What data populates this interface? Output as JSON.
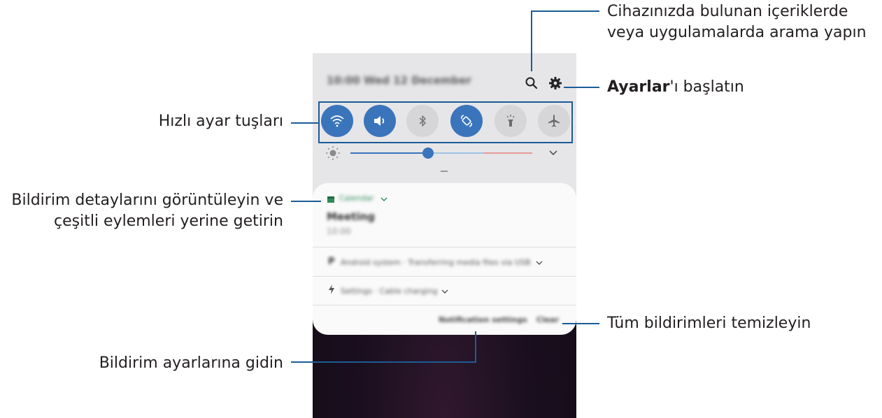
{
  "callouts": {
    "search_line1": "Cihazınızda bulunan içeriklerde",
    "search_line2": "veya uygulamalarda arama yapın",
    "settings_bold": "Ayarlar",
    "settings_rest": "'ı başlatın",
    "quick_settings": "Hızlı ayar tuşları",
    "notification_line1": "Bildirim detaylarını görüntüleyin ve",
    "notification_line2": "çeşitli eylemleri yerine getirin",
    "clear_all": "Tüm bildirimleri temizleyin",
    "notification_settings": "Bildirim ayarlarına gidin"
  },
  "phone": {
    "status_bar": "10:00  Wed 12 December",
    "quick_settings": [
      {
        "icon": "wifi-icon",
        "state": "on"
      },
      {
        "icon": "sound-icon",
        "state": "on"
      },
      {
        "icon": "bluetooth-icon",
        "state": "off"
      },
      {
        "icon": "auto-rotate-icon",
        "state": "on"
      },
      {
        "icon": "flashlight-icon",
        "state": "off"
      },
      {
        "icon": "airplane-mode-icon",
        "state": "off"
      }
    ],
    "brightness": 0.4,
    "notifications": [
      {
        "app": "Calendar",
        "title": "Meeting",
        "text": "10:00"
      },
      {
        "app": "Android system",
        "text": "Transferring media files via USB"
      },
      {
        "app": "Settings",
        "text": "Cable charging"
      }
    ],
    "notification_settings_label": "Notification settings",
    "clear_label": "Clear"
  },
  "colors": {
    "accent": "#1b5c97",
    "toggle_on": "#3a74bb",
    "toggle_off": "#d6d6d8",
    "calendar_green": "#2e8b57"
  }
}
